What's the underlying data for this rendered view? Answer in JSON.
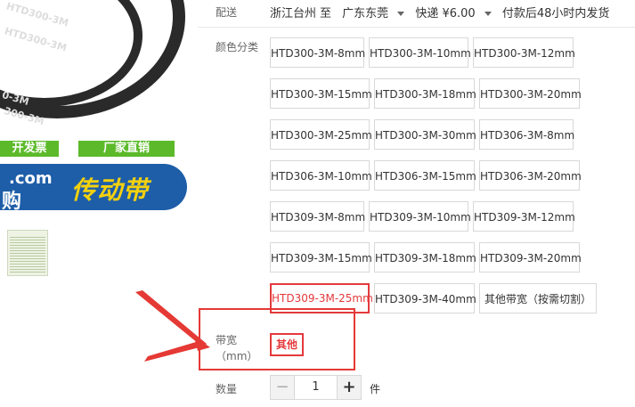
{
  "product_image": {
    "belt_texts": [
      "HTD300-3M",
      "HTD300-3M",
      "0-3M",
      "300-3M"
    ],
    "promo_left": "开发票",
    "promo_right": "厂家直销",
    "banner_domain": ".com",
    "banner_gou": "购",
    "banner_main": "传动带"
  },
  "shipping": {
    "label": "配送",
    "from": "浙江台州",
    "to_word": "至",
    "to": "广东东莞",
    "express": "快递 ¥6.00",
    "promise": "付款后48小时内发货"
  },
  "color": {
    "label": "颜色分类",
    "options": [
      "HTD300-3M-8mm",
      "HTD300-3M-10mm",
      "HTD300-3M-12mm",
      "HTD300-3M-15mm",
      "HTD300-3M-18mm",
      "HTD300-3M-20mm",
      "HTD300-3M-25mm",
      "HTD300-3M-30mm",
      "HTD306-3M-8mm",
      "HTD306-3M-10mm",
      "HTD306-3M-15mm",
      "HTD306-3M-20mm",
      "HTD309-3M-8mm",
      "HTD309-3M-10mm",
      "HTD309-3M-12mm",
      "HTD309-3M-15mm",
      "HTD309-3M-18mm",
      "HTD309-3M-20mm",
      "HTD309-3M-25mm",
      "HTD309-3M-40mm",
      "其他带宽（按需切割）"
    ],
    "selected": "HTD309-3M-25mm"
  },
  "width": {
    "label": "带宽（mm）",
    "selected": "其他"
  },
  "quantity": {
    "label": "数量",
    "value": "1",
    "minus": "−",
    "plus": "+",
    "unit": "件"
  },
  "colors": {
    "accent": "#e4393c",
    "annotation": "#e53935",
    "banner": "#1e5ea8",
    "promo": "#5cba2a"
  }
}
